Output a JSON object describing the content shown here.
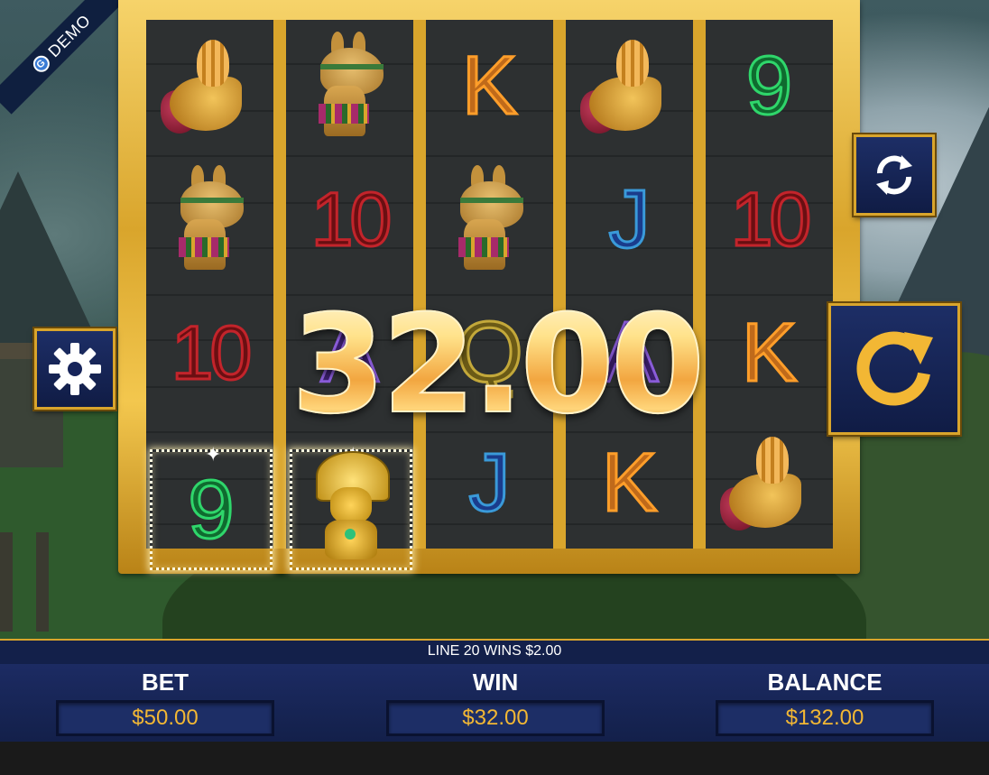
{
  "badge": {
    "label": "DEMO",
    "logo_letter": "G"
  },
  "reels": [
    [
      "horn",
      "llama",
      "10",
      "9"
    ],
    [
      "llama",
      "10",
      "A",
      "idol"
    ],
    [
      "K",
      "llama",
      "Q",
      "J"
    ],
    [
      "horn",
      "J",
      "A",
      "K"
    ],
    [
      "9",
      "10",
      "K",
      "horn"
    ]
  ],
  "win_amount": "32.00",
  "info_message": "LINE 20 WINS $2.00",
  "meters": {
    "bet": {
      "label": "BET",
      "value": "$50.00"
    },
    "win": {
      "label": "WIN",
      "value": "$32.00"
    },
    "balance": {
      "label": "BALANCE",
      "value": "$132.00"
    }
  },
  "colors": {
    "gold": "#d9a52c",
    "navy": "#13204a",
    "accent": "#f2b734"
  },
  "icons": {
    "autoplay": "refresh-icon",
    "settings": "gear-icon",
    "spin": "spin-arrow-icon"
  }
}
